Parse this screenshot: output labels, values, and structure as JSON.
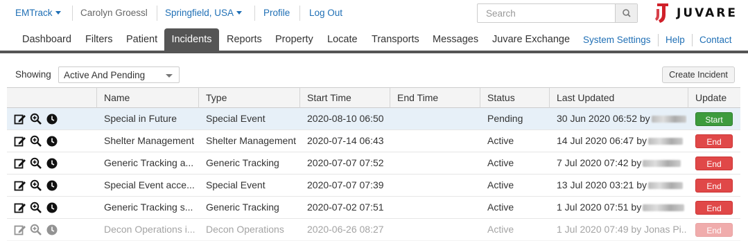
{
  "topbar": {
    "app": "EMTrack",
    "user": "Carolyn Groessl",
    "location": "Springfield, USA",
    "profile": "Profile",
    "logout": "Log Out",
    "search_placeholder": "Search",
    "logo_text": "JUVARE",
    "link_color": "#1f6fb5",
    "logo_color": "#d0202a"
  },
  "nav": {
    "tabs": [
      "Dashboard",
      "Filters",
      "Patient",
      "Incidents",
      "Reports",
      "Property",
      "Locate",
      "Transports",
      "Messages",
      "Juvare Exchange"
    ],
    "active": "Incidents",
    "right_links": [
      "System Settings",
      "Help",
      "Contact"
    ]
  },
  "toolbar": {
    "showing_label": "Showing",
    "filter_value": "Active And Pending",
    "create_label": "Create Incident"
  },
  "table": {
    "columns": [
      "",
      "Name",
      "Type",
      "Start Time",
      "End Time",
      "Status",
      "Last Updated",
      "Update"
    ],
    "rows": [
      {
        "name": "Special in Future",
        "type": "Special Event",
        "start": "2020-08-10 06:50",
        "end": "",
        "status": "Pending",
        "updated": "30 Jun 2020 06:52 by",
        "action": "Start"
      },
      {
        "name": "Shelter Management",
        "type": "Shelter Management",
        "start": "2020-07-14 06:43",
        "end": "",
        "status": "Active",
        "updated": "14 Jul 2020 06:47 by",
        "action": "End"
      },
      {
        "name": "Generic Tracking a...",
        "type": "Generic Tracking",
        "start": "2020-07-07 07:52",
        "end": "",
        "status": "Active",
        "updated": "7 Jul 2020 07:42 by",
        "action": "End"
      },
      {
        "name": "Special Event acce...",
        "type": "Special Event",
        "start": "2020-07-07 07:39",
        "end": "",
        "status": "Active",
        "updated": "13 Jul 2020 03:21 by",
        "action": "End"
      },
      {
        "name": "Generic Tracking s...",
        "type": "Generic Tracking",
        "start": "2020-07-02 07:51",
        "end": "",
        "status": "Active",
        "updated": "1 Jul 2020 07:51 by",
        "action": "End"
      },
      {
        "name": "Decon Operations i...",
        "type": "Decon Operations",
        "start": "2020-06-26 08:27",
        "end": "",
        "status": "Active",
        "updated": "1 Jul 2020 07:49 by Jonas Pi...",
        "action": "End"
      }
    ],
    "start_color": "#3d9b3d",
    "end_color": "#e04848",
    "highlight_color": "#e7f0f8"
  },
  "icons": [
    "edit-icon",
    "zoom-in-icon",
    "clock-icon",
    "search-icon",
    "caret-down-icon",
    "juvare-logo-icon"
  ]
}
